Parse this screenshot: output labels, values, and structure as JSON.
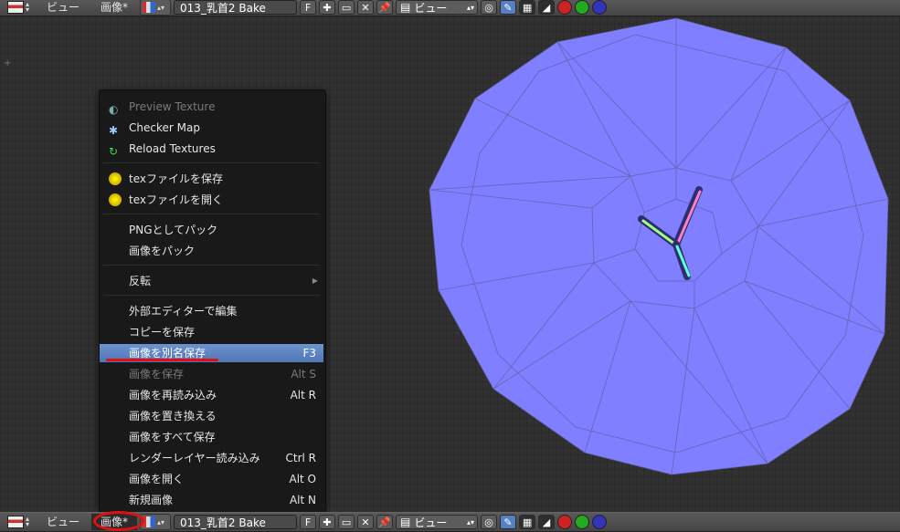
{
  "header": {
    "view_menu": "ビュー",
    "image_menu": "画像*",
    "image_name": "013_乳首2 Bake",
    "fake_user": "F",
    "view_mode": "ビュー"
  },
  "popup": {
    "items": [
      {
        "label": "Preview Texture",
        "shortcut": "",
        "state": "disabled",
        "icon": "preview-icon"
      },
      {
        "label": "Checker Map",
        "shortcut": "",
        "state": "normal",
        "icon": "checker-map-icon"
      },
      {
        "label": "Reload Textures",
        "shortcut": "",
        "state": "normal",
        "icon": "reload-icon"
      },
      {
        "label": "texファイルを保存",
        "shortcut": "",
        "state": "normal",
        "icon": "tex-save-icon"
      },
      {
        "label": "texファイルを開く",
        "shortcut": "",
        "state": "normal",
        "icon": "tex-open-icon"
      },
      {
        "label": "PNGとしてパック",
        "shortcut": "",
        "state": "normal",
        "icon": ""
      },
      {
        "label": "画像をパック",
        "shortcut": "",
        "state": "normal",
        "icon": ""
      },
      {
        "label": "反転",
        "shortcut": "",
        "state": "submenu",
        "icon": ""
      },
      {
        "label": "外部エディターで編集",
        "shortcut": "",
        "state": "normal",
        "icon": ""
      },
      {
        "label": "コピーを保存",
        "shortcut": "",
        "state": "normal",
        "icon": ""
      },
      {
        "label": "画像を別名保存",
        "shortcut": "F3",
        "state": "highlighted",
        "icon": ""
      },
      {
        "label": "画像を保存",
        "shortcut": "Alt S",
        "state": "disabled",
        "icon": ""
      },
      {
        "label": "画像を再読み込み",
        "shortcut": "Alt R",
        "state": "normal",
        "icon": ""
      },
      {
        "label": "画像を置き換える",
        "shortcut": "",
        "state": "normal",
        "icon": ""
      },
      {
        "label": "画像をすべて保存",
        "shortcut": "",
        "state": "normal",
        "icon": ""
      },
      {
        "label": "レンダーレイヤー読み込み",
        "shortcut": "Ctrl R",
        "state": "normal",
        "icon": ""
      },
      {
        "label": "画像を開く",
        "shortcut": "Alt O",
        "state": "normal",
        "icon": ""
      },
      {
        "label": "新規画像",
        "shortcut": "Alt N",
        "state": "normal",
        "icon": ""
      }
    ]
  },
  "colors": {
    "texture_fill": "#7f7fff",
    "highlight": "#5680c2",
    "annotation_red": "#e01010"
  }
}
